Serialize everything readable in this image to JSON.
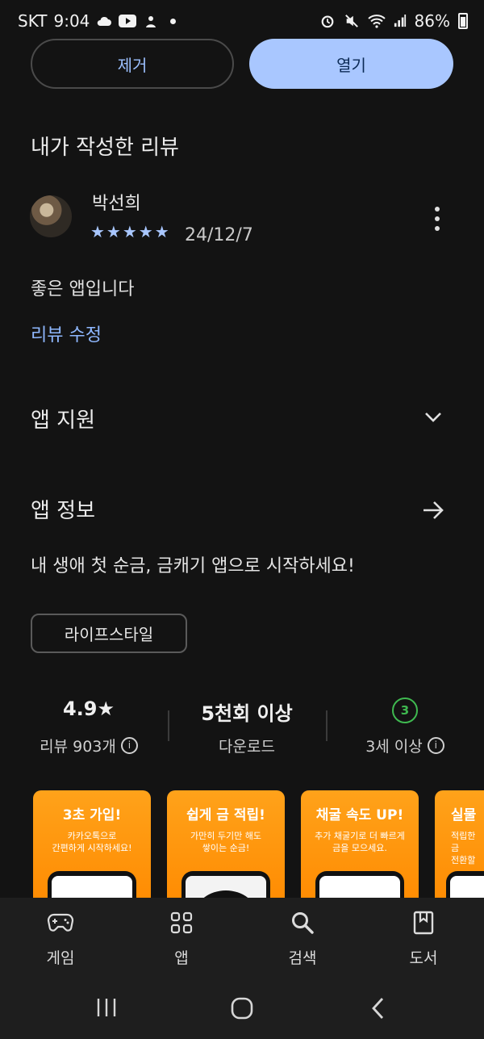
{
  "status_bar": {
    "carrier": "SKT",
    "time": "9:04",
    "battery": "86%"
  },
  "actions": {
    "remove_label": "제거",
    "open_label": "열기"
  },
  "my_review": {
    "section_title": "내가 작성한 리뷰",
    "reviewer_name": "박선희",
    "rating": 5,
    "stars": "★★★★★",
    "date": "24/12/7",
    "text": "좋은 앱입니다",
    "edit_label": "리뷰 수정"
  },
  "app_support": {
    "title": "앱 지원"
  },
  "app_info": {
    "title": "앱 정보",
    "description": "내 생애 첫 순금, 금캐기 앱으로 시작하세요!",
    "category_chip": "라이프스타일"
  },
  "stats": {
    "rating_value": "4.9★",
    "rating_label": "리뷰 903개",
    "downloads_value": "5천회 이상",
    "downloads_label": "다운로드",
    "age_badge": "3",
    "age_label": "3세 이상"
  },
  "screenshots": [
    {
      "title": "3초 가입!",
      "subtitle": "카카오톡으로\n간편하게 시작하세요!"
    },
    {
      "title": "쉽게 금 적립!",
      "subtitle": "가만히 두기만 해도\n쌓이는 순금!"
    },
    {
      "title": "채굴 속도 UP!",
      "subtitle": "추가 채굴기로 더 빠르게\n금을 모으세요."
    },
    {
      "title": "실물",
      "subtitle": "적립한 금\n전환할"
    }
  ],
  "bottom_nav": [
    {
      "label": "게임",
      "icon": "gamepad-icon"
    },
    {
      "label": "앱",
      "icon": "apps-grid-icon"
    },
    {
      "label": "검색",
      "icon": "search-icon"
    },
    {
      "label": "도서",
      "icon": "book-icon"
    }
  ],
  "colors": {
    "accent": "#a9c7ff",
    "background": "#131313",
    "age_green": "#3fb950",
    "screenshot_orange": "#ff9500"
  }
}
